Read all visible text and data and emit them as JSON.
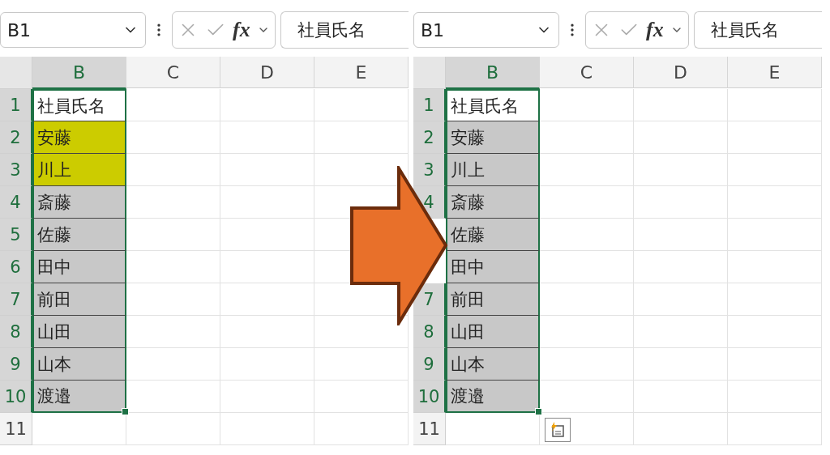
{
  "panels": [
    {
      "name_box": "B1",
      "function_label": "fx",
      "formula": "社員氏名",
      "flash_fill_button": false,
      "columns": [
        {
          "label": "B",
          "selected": true
        },
        {
          "label": "C",
          "selected": false
        },
        {
          "label": "D",
          "selected": false
        },
        {
          "label": "E",
          "selected": false
        }
      ],
      "rows": [
        {
          "label": "1",
          "selected": true,
          "text": "社員氏名"
        },
        {
          "label": "2",
          "selected": true,
          "text": "安藤",
          "color": "#cccc00"
        },
        {
          "label": "3",
          "selected": true,
          "text": "川上",
          "color": "#cccc00"
        },
        {
          "label": "4",
          "selected": true,
          "text": "斎藤",
          "color": "#c8c8c8"
        },
        {
          "label": "5",
          "selected": true,
          "text": "佐藤",
          "color": "#c8c8c8"
        },
        {
          "label": "6",
          "selected": true,
          "text": "田中",
          "color": "#c8c8c8"
        },
        {
          "label": "7",
          "selected": true,
          "text": "前田",
          "color": "#c8c8c8"
        },
        {
          "label": "8",
          "selected": true,
          "text": "山田",
          "color": "#c8c8c8"
        },
        {
          "label": "9",
          "selected": true,
          "text": "山本",
          "color": "#c8c8c8"
        },
        {
          "label": "10",
          "selected": true,
          "text": "渡邉",
          "color": "#c8c8c8"
        },
        {
          "label": "11",
          "selected": false
        }
      ]
    },
    {
      "name_box": "B1",
      "function_label": "fx",
      "formula": "社員氏名",
      "flash_fill_button": true,
      "columns": [
        {
          "label": "B",
          "selected": true
        },
        {
          "label": "C",
          "selected": false
        },
        {
          "label": "D",
          "selected": false
        },
        {
          "label": "E",
          "selected": false
        }
      ],
      "rows": [
        {
          "label": "1",
          "selected": true,
          "text": "社員氏名"
        },
        {
          "label": "2",
          "selected": true,
          "text": "安藤",
          "color": "#c8c8c8"
        },
        {
          "label": "3",
          "selected": true,
          "text": "川上",
          "color": "#c8c8c8"
        },
        {
          "label": "4",
          "selected": true,
          "text": "斎藤",
          "color": "#c8c8c8"
        },
        {
          "selected": true,
          "text": "佐藤",
          "color": "#c8c8c8"
        },
        {
          "selected": true,
          "text": "田中",
          "color": "#c8c8c8"
        },
        {
          "label": "7",
          "selected": true,
          "text": "前田",
          "color": "#c8c8c8"
        },
        {
          "label": "8",
          "selected": true,
          "text": "山田",
          "color": "#c8c8c8"
        },
        {
          "label": "9",
          "selected": true,
          "text": "山本",
          "color": "#c8c8c8"
        },
        {
          "label": "10",
          "selected": true,
          "text": "渡邉",
          "color": "#c8c8c8"
        },
        {
          "label": "11",
          "selected": false
        }
      ]
    }
  ]
}
